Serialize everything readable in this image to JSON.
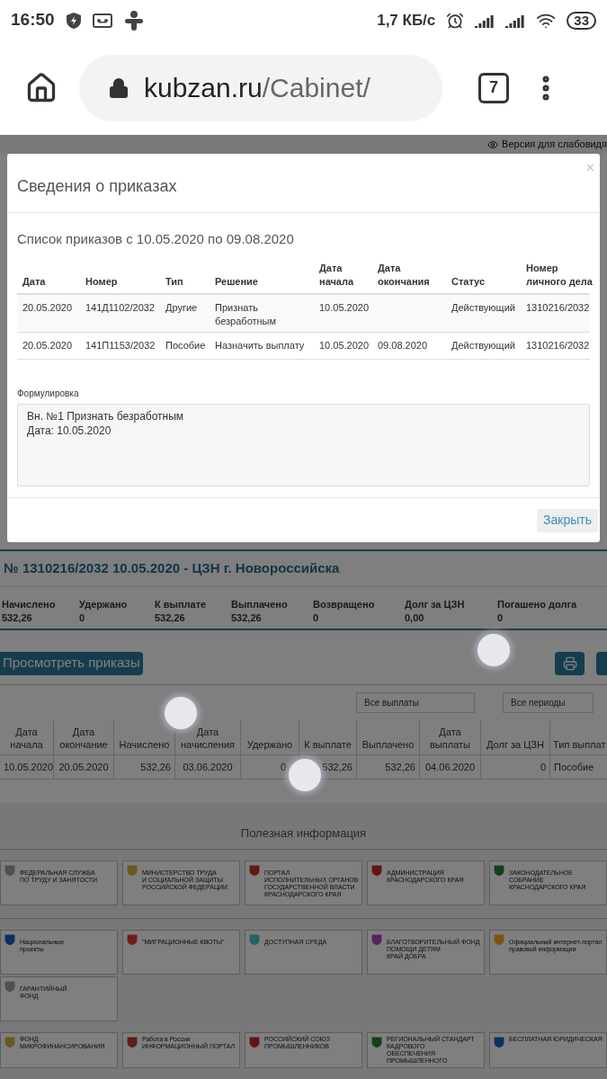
{
  "status_bar": {
    "time": "16:50",
    "speed": "1,7 КБ/с",
    "battery": "33"
  },
  "browser": {
    "url_host": "kubzan.ru",
    "url_path": "/Cabinet/",
    "tab_count": "7"
  },
  "page": {
    "accessibility_link": "Версия для слабовидя",
    "case_title": "№ 1310216/2032 10.05.2020 - ЦЗН г. Новороссийска",
    "summary": [
      {
        "label": "Начислено",
        "value": "532,26"
      },
      {
        "label": "Удержано",
        "value": "0"
      },
      {
        "label": "К выплате",
        "value": "532,26"
      },
      {
        "label": "Выплачено",
        "value": "532,26"
      },
      {
        "label": "Возвращено",
        "value": "0"
      },
      {
        "label": "Долг за ЦЗН",
        "value": "0,00"
      },
      {
        "label": "Погашено долга",
        "value": "0"
      }
    ],
    "view_orders_button": "Просмотреть приказы",
    "filters": [
      "Все выплаты",
      "Все периоды"
    ],
    "payments_table": {
      "columns": [
        "Дата начала",
        "Дата окончание",
        "Начислено",
        "Дата начисления",
        "Удержано",
        "К выплате",
        "Выплачено",
        "Дата выплаты",
        "Долг за ЦЗН",
        "Тип выплат"
      ],
      "rows": [
        [
          "10.05.2020",
          "20.05.2020",
          "532,26",
          "03.06.2020",
          "0",
          "532,26",
          "532,26",
          "04.06.2020",
          "0",
          "Пособие"
        ]
      ]
    },
    "useful_info_title": "Полезная информация",
    "banner_rows": [
      [
        {
          "lines": [
            "ФЕДЕРАЛЬНАЯ СЛУЖБА",
            "ПО ТРУДУ И ЗАНЯТОСТИ"
          ]
        },
        {
          "lines": [
            "МИНИСТЕРСТВО ТРУДА",
            "И СОЦИАЛЬНОЙ ЗАЩИТЫ",
            "РОССИЙСКОЙ ФЕДЕРАЦИИ"
          ]
        },
        {
          "lines": [
            "ПОРТАЛ",
            "ИСПОЛНИТЕЛЬНЫХ ОРГАНОВ",
            "ГОСУДАРСТВЕННОЙ ВЛАСТИ",
            "КРАСНОДАРСКОГО КРАЯ"
          ]
        },
        {
          "lines": [
            "АДМИНИСТРАЦИЯ",
            "КРАСНОДАРСКОГО КРАЯ"
          ]
        },
        {
          "lines": [
            "ЗАКОНОДАТЕЛЬНОЕ",
            "СОБРАНИЕ",
            "КРАСНОДАРСКОГО КРАЯ"
          ]
        }
      ],
      [
        {
          "lines": [
            "Национальные",
            "проекты"
          ]
        },
        {
          "lines": [
            "\"МИГРАЦИОННЫЕ КВОТЫ\""
          ]
        },
        {
          "lines": [
            "ДОСТУПНАЯ СРЕДА"
          ]
        },
        {
          "lines": [
            "БЛАГОТВОРИТЕЛЬНЫЙ ФОНД ПОМОЩИ ДЕТЯМ",
            "КРАЙ ДОБРА"
          ]
        },
        {
          "lines": [
            "Официальный интернет-портал",
            "правовой информации"
          ]
        }
      ],
      [
        {
          "lines": [
            "ГАРАНТИЙНЫЙ",
            "ФОНД"
          ]
        }
      ],
      [
        {
          "lines": [
            "ФОНД",
            "МИКРОФИНАНСИРОВАНИЯ"
          ]
        },
        {
          "lines": [
            "Работа в России",
            "ИНФОРМАЦИОННЫЙ ПОРТАЛ"
          ]
        },
        {
          "lines": [
            "РОССИЙСКИЙ СОЮЗ",
            "ПРОМЫШЛЕННИКОВ"
          ]
        },
        {
          "lines": [
            "РЕГИОНАЛЬНЫЙ СТАНДАРТ КАДРОВОГО",
            "ОБЕСПЕЧЕНИЯ ПРОМЫШЛЕННОГО"
          ]
        },
        {
          "lines": [
            "БЕСПЛАТНАЯ ЮРИДИЧЕСКАЯ"
          ]
        }
      ]
    ]
  },
  "modal": {
    "title": "Сведения о приказах",
    "close_icon": "×",
    "list_title": "Список приказов с 10.05.2020 по 09.08.2020",
    "columns": [
      "Дата",
      "Номер",
      "Тип",
      "Решение",
      "Дата начала",
      "Дата окончания",
      "Статус",
      "Номер личного дела"
    ],
    "rows": [
      [
        "20.05.2020",
        "141Д1102/2032",
        "Другие",
        "Признать безработным",
        "10.05.2020",
        "",
        "Действующий",
        "1310216/2032"
      ],
      [
        "20.05.2020",
        "141П1153/2032",
        "Пособие",
        "Назначить выплату",
        "10.05.2020",
        "09.08.2020",
        "Действующий",
        "1310216/2032"
      ]
    ],
    "wording_label": "Формулировка",
    "wording_lines": [
      "Вн. №1 Признать безработным",
      "Дата: 10.05.2020"
    ],
    "close_button": "Закрыть"
  }
}
